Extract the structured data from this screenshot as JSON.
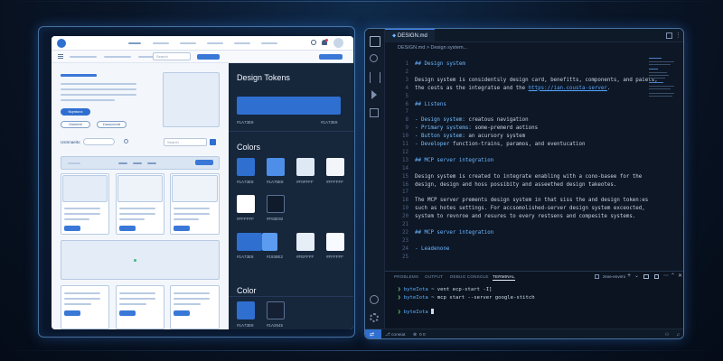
{
  "design_panel": {
    "search_placeholder": "Search",
    "hero": {
      "primary_button": "Nqmtonx",
      "secondary_buttons": [
        "Owmtrei",
        "Dosoocnnt"
      ]
    },
    "filters": {
      "label": "Usmnaeito",
      "search_placeholder": "Search"
    },
    "tokens": {
      "title": "Design Tokens",
      "primary": {
        "left_label": "#1A73E8",
        "right_label": "#1A73E8"
      },
      "colors_title": "Colors",
      "colors_row1": [
        {
          "label": "#1A73E8",
          "color": "#2f6fd0"
        },
        {
          "label": "#1A75E8",
          "color": "#4c8ee8"
        },
        {
          "label": "#F0FFFF",
          "color": "#dfe9f6"
        },
        {
          "label": "#FFFFFF",
          "color": "#f2f6fb"
        }
      ],
      "colors_row2": [
        {
          "label": "#FFFFFF",
          "color": "#ffffff"
        },
        {
          "label": "#F83E92",
          "color": "#0f1b2b"
        }
      ],
      "colors_row3": [
        {
          "label": "#1A73E8",
          "color": "#2f6fd0"
        },
        {
          "label": "#1938E2",
          "color": "#5b9bf0"
        },
        {
          "label": "#FEFFFF",
          "color": "#e6eef8"
        },
        {
          "label": "#FFFFFF",
          "color": "#f7fafe"
        }
      ],
      "color_title": "Color",
      "color_row": [
        {
          "label": "#1A73E8",
          "color": "#2f6fd0"
        },
        {
          "label": "#1A2545",
          "color": "#152035"
        }
      ]
    }
  },
  "ide": {
    "tab_label": "DESIGN.md",
    "breadcrumb": "DESIGN.md > Design system...",
    "lines": [
      {
        "n": "1",
        "text": "## Design system",
        "kind": "h"
      },
      {
        "n": "2",
        "text": "",
        "kind": "t"
      },
      {
        "n": "3",
        "text": "Design system is considentsly design card, benefitts, components, and paiets,",
        "kind": "t"
      },
      {
        "n": "4",
        "text": "the cests as the integratse and the ",
        "link": "https://ian.cousta-server",
        "after": ".",
        "kind": "link"
      },
      {
        "n": "5",
        "text": "",
        "kind": "t"
      },
      {
        "n": "6",
        "text": "## Listens",
        "kind": "h"
      },
      {
        "n": "7",
        "text": "",
        "kind": "t"
      },
      {
        "n": "8",
        "kw": "- Design system:",
        "text": " creatous navigation",
        "kind": "kw"
      },
      {
        "n": "9",
        "kw": "- Primary systems:",
        "text": " some-premerd aotions",
        "kind": "kw"
      },
      {
        "n": "10",
        "kw": "- Button system:",
        "text": " an acursory system",
        "kind": "kw"
      },
      {
        "n": "11",
        "kw": "- Developer",
        "text": " function-trains, paramos, and eventucation",
        "kind": "kw"
      },
      {
        "n": "12",
        "text": "",
        "kind": "t"
      },
      {
        "n": "13",
        "text": "## MCP server integration",
        "kind": "h"
      },
      {
        "n": "14",
        "text": "",
        "kind": "t"
      },
      {
        "n": "15",
        "text": "Design system is created to integrate enabling with a cono-basee for the",
        "kind": "t"
      },
      {
        "n": "16",
        "text": "design, design and hoss possibity and asseethed design takeotes.",
        "kind": "t"
      },
      {
        "n": "17",
        "text": "",
        "kind": "t"
      },
      {
        "n": "18",
        "text": "The MCP server prements design system in that siss the and design token:es",
        "kind": "t"
      },
      {
        "n": "19",
        "text": "such as hotes settings. For accsomolished-server design system exceocted,",
        "kind": "t"
      },
      {
        "n": "20",
        "text": "system to revnroe and resures to every restsens and compesite systems.",
        "kind": "t"
      },
      {
        "n": "21",
        "text": "",
        "kind": "t"
      },
      {
        "n": "22",
        "text": "## MCP server integration",
        "kind": "h"
      },
      {
        "n": "23",
        "text": "",
        "kind": "t"
      },
      {
        "n": "24",
        "text": "- Leadenone",
        "kind": "h"
      },
      {
        "n": "25",
        "text": "",
        "kind": "t"
      }
    ],
    "terminal": {
      "tabs": [
        "PROBLEMS",
        "OUTPUT",
        "DEBUG CONSOLE",
        "TERMINAL"
      ],
      "active_tab": "TERMINAL",
      "shell_label": "zsne-envirni",
      "lines": [
        {
          "prompt": "byteIota",
          "sep": " ~ ",
          "cmd": "vent ecp-start -I]"
        },
        {
          "prompt": "byteIota",
          "sep": " ~ ",
          "cmd": "mcp start --server google-stitch"
        },
        {
          "prompt": "byteIota",
          "sep": " ",
          "cmd": ""
        }
      ]
    },
    "status": {
      "branch": "coneiat",
      "problems": "0  0"
    }
  }
}
